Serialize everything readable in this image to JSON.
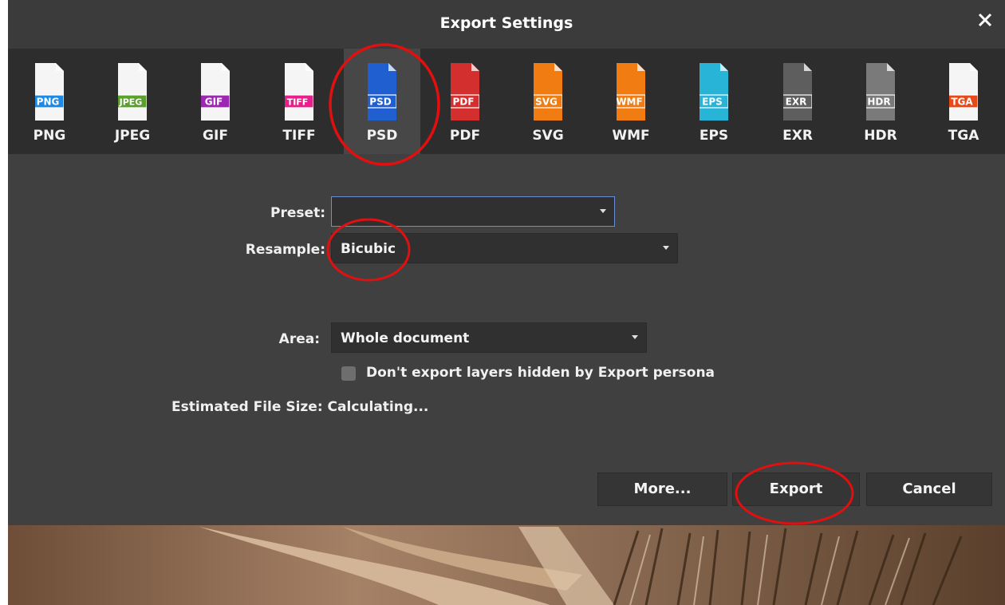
{
  "dialog": {
    "title": "Export Settings",
    "close_icon": "close-icon"
  },
  "formats": [
    {
      "label": "PNG",
      "tag": "PNG",
      "color": "#1e88e5",
      "selected": false
    },
    {
      "label": "JPEG",
      "tag": "JPEG",
      "color": "#5aa02c",
      "selected": false
    },
    {
      "label": "GIF",
      "tag": "GIF",
      "color": "#9c27b0",
      "selected": false
    },
    {
      "label": "TIFF",
      "tag": "TIFF",
      "color": "#e91e8c",
      "selected": false
    },
    {
      "label": "PSD",
      "tag": "PSD",
      "color": "#1f5fd0",
      "selected": true
    },
    {
      "label": "PDF",
      "tag": "PDF",
      "color": "#d32f2f",
      "selected": false
    },
    {
      "label": "SVG",
      "tag": "SVG",
      "color": "#f07c12",
      "selected": false
    },
    {
      "label": "WMF",
      "tag": "WMF",
      "color": "#f07c12",
      "selected": false
    },
    {
      "label": "EPS",
      "tag": "EPS",
      "color": "#27b4d6",
      "selected": false
    },
    {
      "label": "EXR",
      "tag": "EXR",
      "color": "#5e5e5e",
      "selected": false
    },
    {
      "label": "HDR",
      "tag": "HDR",
      "color": "#7a7a7a",
      "selected": false
    },
    {
      "label": "TGA",
      "tag": "TGA",
      "color": "#e64a19",
      "selected": false
    }
  ],
  "form": {
    "preset_label": "Preset:",
    "preset_value": "",
    "resample_label": "Resample:",
    "resample_value": "Bicubic",
    "area_label": "Area:",
    "area_value": "Whole document",
    "hidden_layers_label": "Don't export layers hidden by Export persona",
    "hidden_layers_checked": false,
    "estimated_size": "Estimated File Size: Calculating..."
  },
  "buttons": {
    "more": "More...",
    "export": "Export",
    "cancel": "Cancel"
  },
  "colors": {
    "annotation": "#e01010",
    "dialog_bg": "#404040",
    "format_bar_bg": "#2d2d2d"
  }
}
